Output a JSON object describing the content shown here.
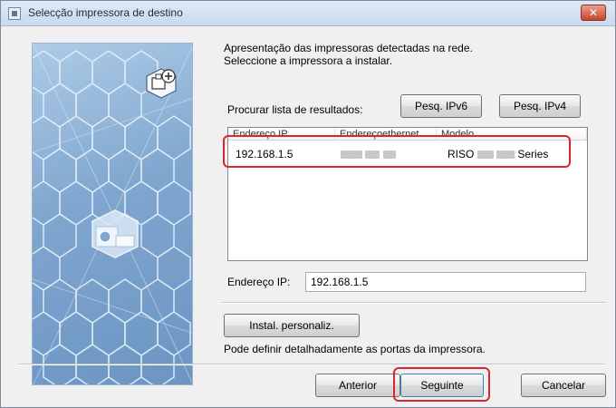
{
  "window": {
    "title": "Selecção impressora de destino",
    "close_label": "✕"
  },
  "intro": {
    "line1": "Apresentação das impressoras detectadas na rede.",
    "line2": "Seleccione a impressora a instalar."
  },
  "search": {
    "label": "Procurar lista de resultados:",
    "ipv6_button": "Pesq. IPv6",
    "ipv4_button": "Pesq. IPv4"
  },
  "printer_list": {
    "columns": [
      "Endereço IP",
      "Endereçoethernet",
      "Modelo"
    ],
    "rows": [
      {
        "ip": "192.168.1.5",
        "model_prefix": "RISO",
        "model_suffix": "Series"
      }
    ]
  },
  "ip_field": {
    "label": "Endereço IP:",
    "value": "192.168.1.5"
  },
  "custom_install": {
    "button": "Instal. personaliz.",
    "description": "Pode definir detalhadamente as portas da impressora."
  },
  "footer": {
    "back_button": "Anterior",
    "next_button": "Seguinte",
    "cancel_button": "Cancelar"
  },
  "colors": {
    "highlight": "#d8282e",
    "close_button": "#c8442c",
    "side_panel": "#7fa6cf"
  },
  "icons": {
    "title": "app-window-icon",
    "close": "close-icon",
    "printer": "printer-plus-icon",
    "device": "device-icon"
  }
}
